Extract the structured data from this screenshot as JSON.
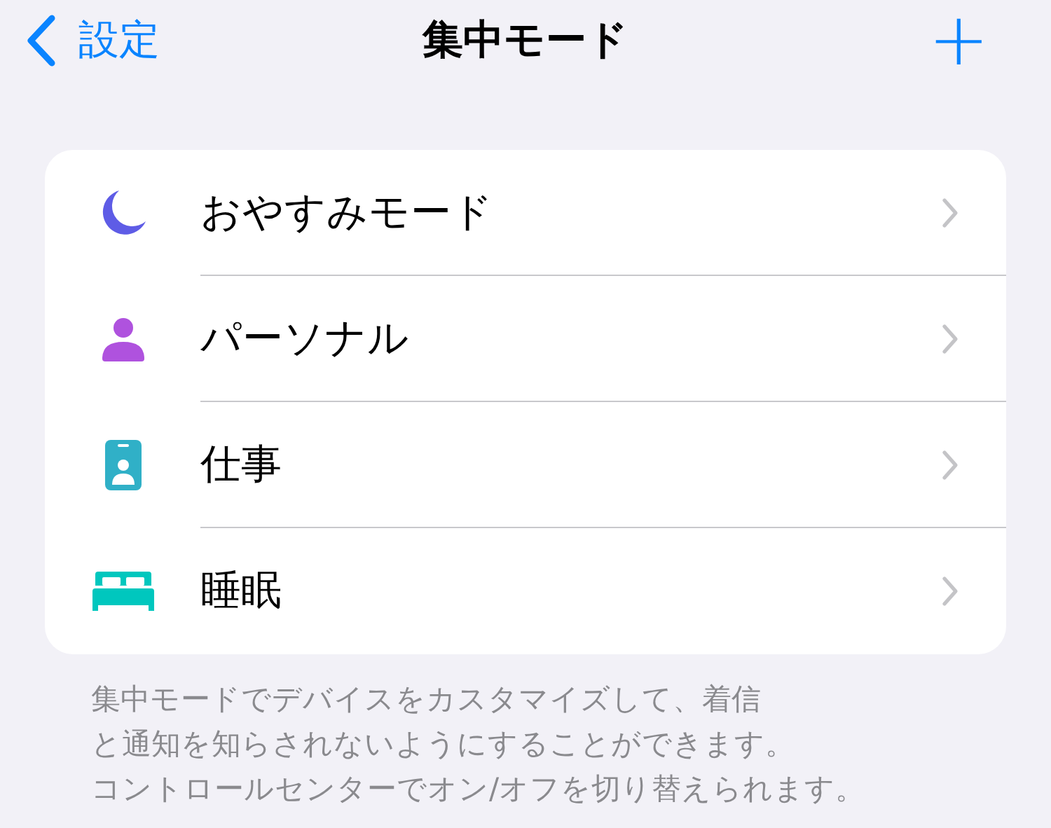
{
  "nav": {
    "back": "設定",
    "title": "集中モード",
    "add": "+"
  },
  "modes": [
    {
      "kind": "moon",
      "label": "おやすみモード",
      "color": "#5e5ce6"
    },
    {
      "kind": "person",
      "label": "パーソナル",
      "color": "#af52de"
    },
    {
      "kind": "badge",
      "label": "仕事",
      "color": "#30b0c7"
    },
    {
      "kind": "bed",
      "label": "睡眠",
      "color": "#00c7be"
    }
  ],
  "footer": [
    "集中モードでデバイスをカスタマイズして、着信",
    "と通知を知らされないようにすることができます。",
    "コントロールセンターでオン/オフを切り替えられます。"
  ]
}
